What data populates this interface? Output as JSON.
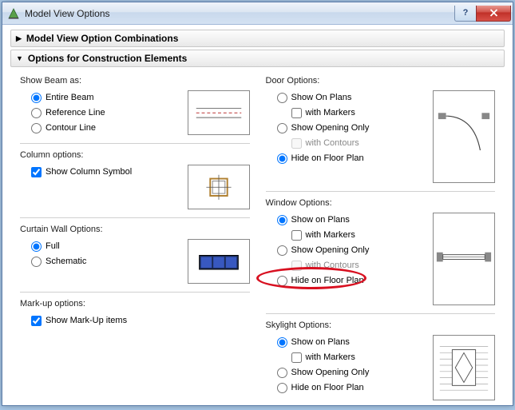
{
  "window": {
    "title": "Model View Options"
  },
  "sections": {
    "combinations": "Model View Option Combinations",
    "construction": "Options for Construction Elements"
  },
  "beam": {
    "title": "Show Beam as:",
    "entire": "Entire Beam",
    "reference": "Reference Line",
    "contour": "Contour Line"
  },
  "column": {
    "title": "Column options:",
    "symbol": "Show Column Symbol"
  },
  "curtain": {
    "title": "Curtain Wall Options:",
    "full": "Full",
    "schematic": "Schematic"
  },
  "markup": {
    "title": "Mark-up options:",
    "show": "Show Mark-Up items"
  },
  "door": {
    "title": "Door Options:",
    "showPlans": "Show On Plans",
    "withMarkers": "with Markers",
    "openingOnly": "Show Opening Only",
    "withContours": "with Contours",
    "hide": "Hide on Floor Plan"
  },
  "windowOpt": {
    "title": "Window Options:",
    "showPlans": "Show on Plans",
    "withMarkers": "with Markers",
    "openingOnly": "Show Opening Only",
    "withContours": "with Contours",
    "hide": "Hide on Floor Plan"
  },
  "skylight": {
    "title": "Skylight Options:",
    "showPlans": "Show on Plans",
    "withMarkers": "with Markers",
    "openingOnly": "Show Opening Only",
    "hide": "Hide on Floor Plan"
  }
}
